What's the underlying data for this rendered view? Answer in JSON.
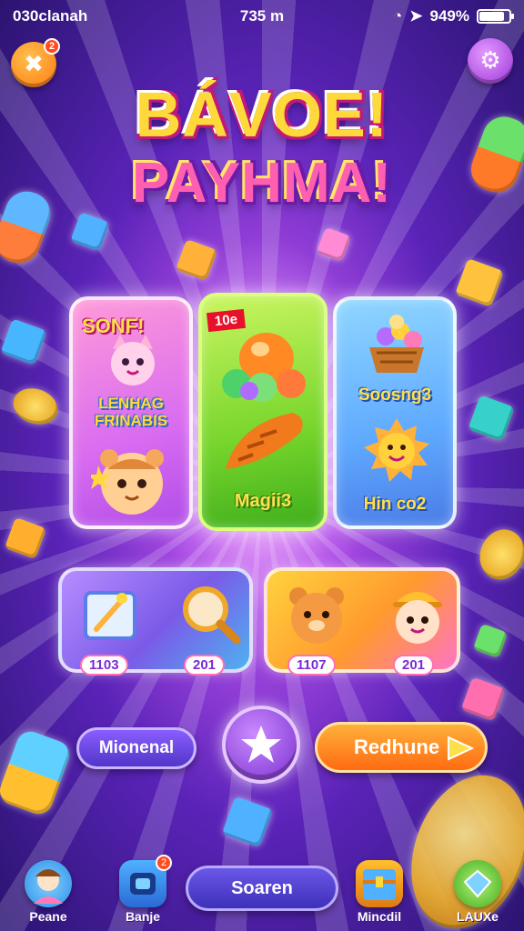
{
  "status_bar": {
    "carrier": "030clanah",
    "time": "735 m",
    "battery": "949%"
  },
  "top_bar": {
    "close_badge": "2"
  },
  "title": {
    "line1": "BÁVOE!",
    "line2": "PAYHMA!"
  },
  "cards": [
    {
      "top_text": "SONF!",
      "middle_text": "LENHAG FRINABIS"
    },
    {
      "tag": "10e",
      "bottom_text": "Magii3"
    },
    {
      "middle_text": "Soosng3",
      "bottom_text": "Hin co2"
    }
  ],
  "rewards": {
    "left": {
      "count_1": "1103",
      "count_2": "201"
    },
    "right": {
      "count_1": "1107",
      "count_2": "201"
    }
  },
  "actions": {
    "left_label": "Mionenal",
    "right_label": "Redhune"
  },
  "bottom_nav": {
    "item_1": "Peane",
    "item_2": "Banje",
    "item_2_badge": "2",
    "search_label": "Soaren",
    "item_4": "Mincdil",
    "item_5": "LAUXe"
  },
  "colors": {
    "background": "#5a23b8",
    "accent_orange": "#ff7a12",
    "accent_purple": "#9a33d9",
    "title_yellow": "#ffd93a",
    "title_pink": "#ff5fb0"
  },
  "icons": {
    "close": "puzzle-close-icon",
    "settings": "gear-icon",
    "star": "star-icon",
    "play": "play-arrow-icon"
  }
}
